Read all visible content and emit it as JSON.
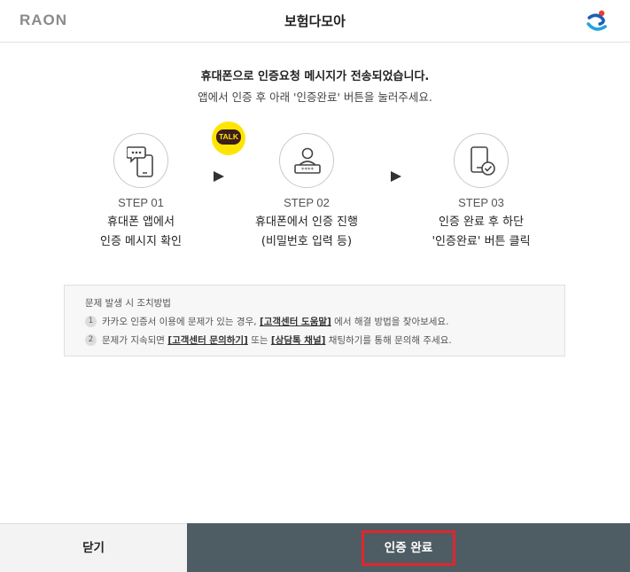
{
  "header": {
    "logo_text": "RAON",
    "title": "보험다모아",
    "right_logo_icon": "government-emblem-icon"
  },
  "message": {
    "line1": "휴대폰으로 인증요청 메시지가 전송되었습니다.",
    "line2": "앱에서 인증 후 아래 '인증완료' 버튼을 눌러주세요."
  },
  "steps": [
    {
      "number": "STEP 01",
      "desc1": "휴대폰 앱에서",
      "desc2": "인증 메시지 확인",
      "icon": "phone-message-icon",
      "badge": "TALK"
    },
    {
      "number": "STEP 02",
      "desc1": "휴대폰에서 인증 진행",
      "desc2": "(비밀번호 입력 등)",
      "icon": "user-password-icon"
    },
    {
      "number": "STEP 03",
      "desc1": "인증 완료 후 하단",
      "desc2": "'인증완료' 버튼 클릭",
      "icon": "phone-check-icon"
    }
  ],
  "notice": {
    "title": "문제 발생 시 조치방법",
    "items": [
      {
        "num": "1",
        "pre": "카카오 인증서 이용에 문제가 있는 경우,",
        "link": "[고객센터 도움말]",
        "post": "에서 해결 방법을 찾아보세요."
      },
      {
        "num": "2",
        "pre": "문제가 지속되면",
        "link": "[고객센터 문의하기]",
        "mid": "또는",
        "link2": "[상담톡 채널]",
        "post": "채팅하기를 통해 문의해 주세요."
      }
    ]
  },
  "footer": {
    "close_label": "닫기",
    "done_label": "인증 완료"
  },
  "colors": {
    "accent_red": "#e1262d",
    "footer_dark": "#4e5c63",
    "kakao_yellow": "#fee500"
  }
}
